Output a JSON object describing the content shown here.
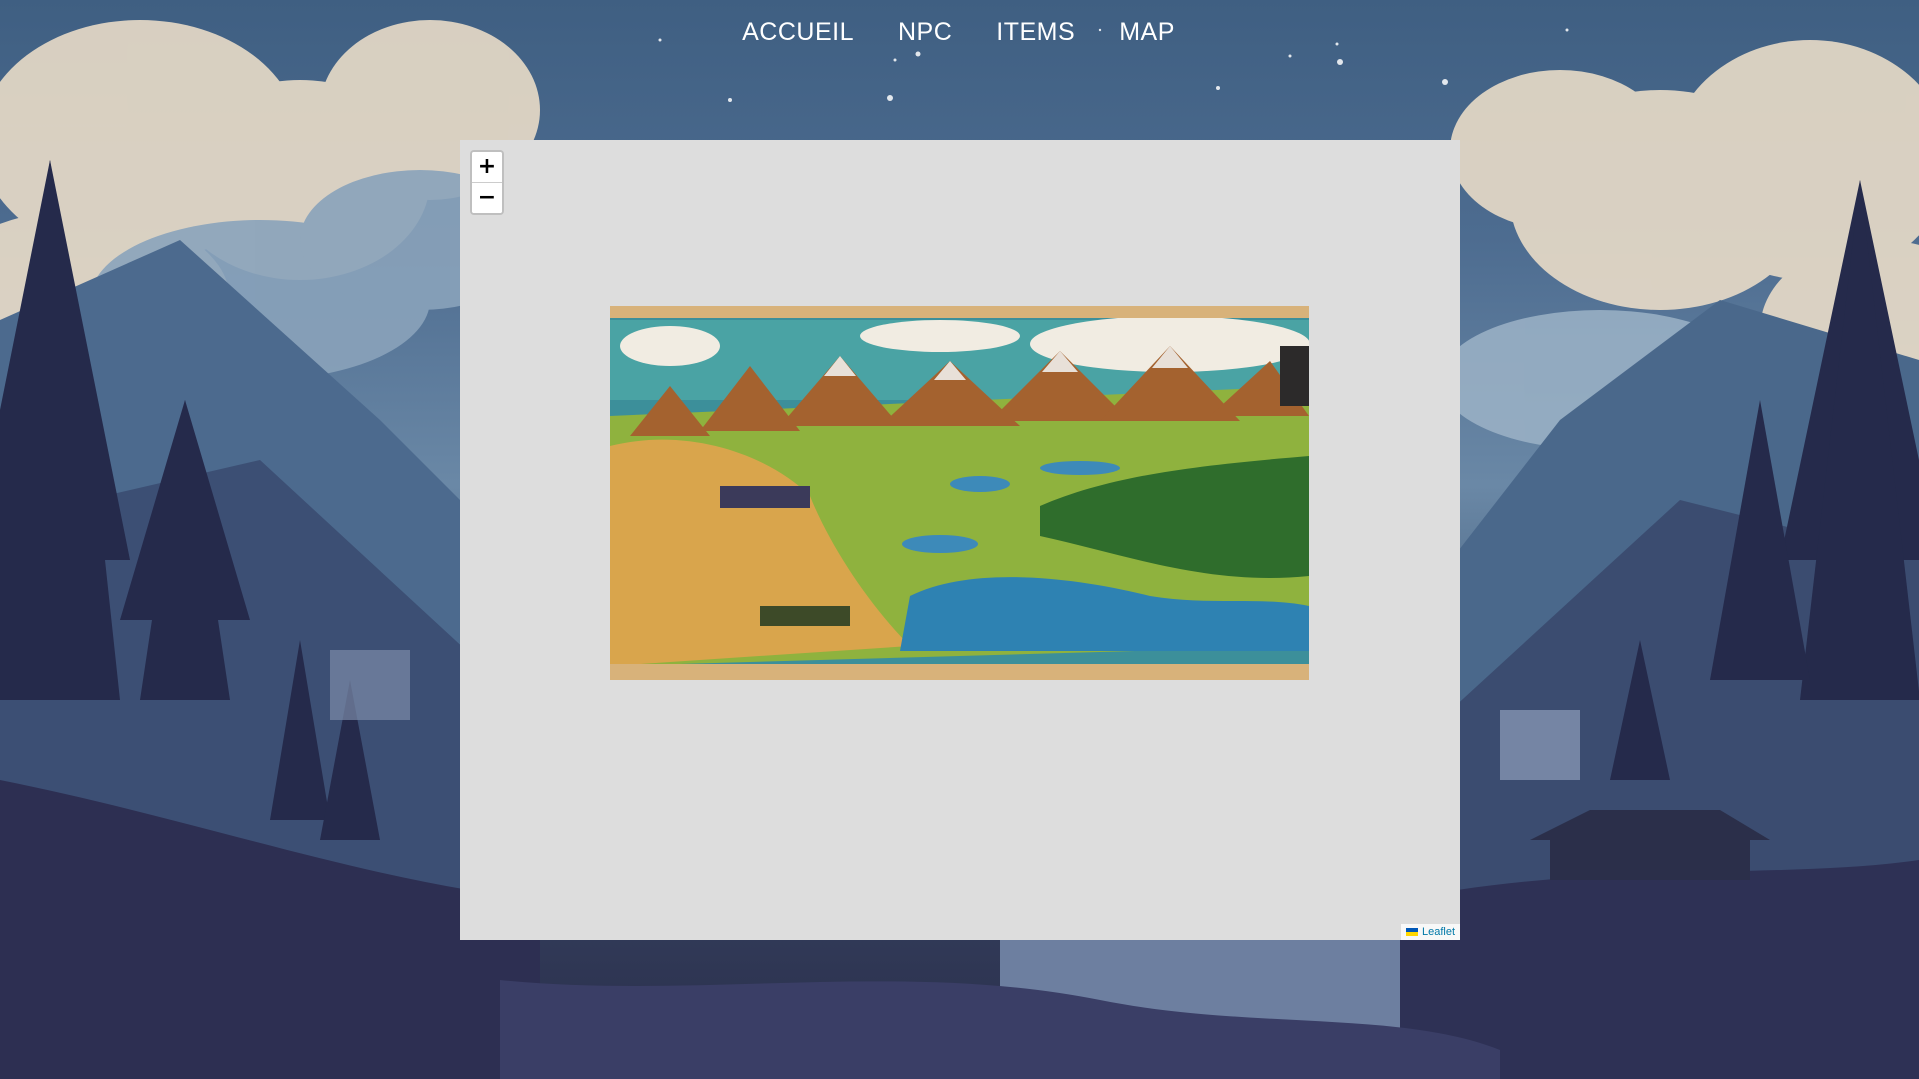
{
  "nav": {
    "items": [
      {
        "label": "ACCUEIL"
      },
      {
        "label": "NPC"
      },
      {
        "label": "ITEMS"
      },
      {
        "label": "MAP"
      }
    ]
  },
  "map": {
    "zoom_in_label": "+",
    "zoom_out_label": "−",
    "attribution": {
      "flag_icon": "ukraine-flag-icon",
      "link_label": "Leaflet"
    },
    "background_color": "#dddddd"
  },
  "colors": {
    "nav_text": "#ffffff",
    "attribution_link": "#0078a8"
  }
}
